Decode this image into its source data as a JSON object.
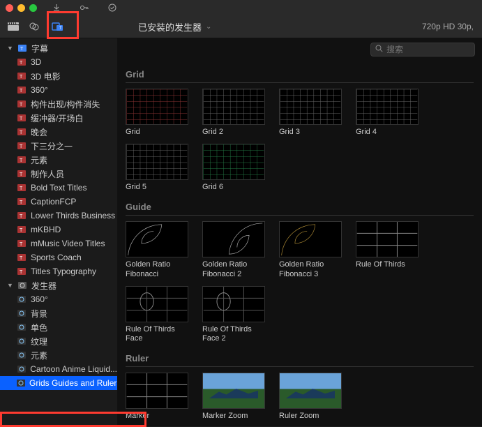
{
  "titlebar": {
    "download": "↓",
    "key": "⚿",
    "check": "✓"
  },
  "topbar": {
    "dropdown_label": "已安装的发生器",
    "format": "720p HD 30p,"
  },
  "search": {
    "placeholder": "搜索"
  },
  "sidebar": {
    "cat_titles": {
      "label": "字幕"
    },
    "cat_gen": {
      "label": "发生器"
    },
    "titles": [
      {
        "label": "3D"
      },
      {
        "label": "3D 电影"
      },
      {
        "label": "360°"
      },
      {
        "label": "构件出现/构件消失"
      },
      {
        "label": "缓冲器/开场白"
      },
      {
        "label": "晚会"
      },
      {
        "label": "下三分之一"
      },
      {
        "label": "元素"
      },
      {
        "label": "制作人员"
      },
      {
        "label": "Bold Text Titles"
      },
      {
        "label": "CaptionFCP"
      },
      {
        "label": "Lower Thirds Business"
      },
      {
        "label": "mKBHD"
      },
      {
        "label": "mMusic Video Titles"
      },
      {
        "label": "Sports Coach"
      },
      {
        "label": "Titles Typography"
      }
    ],
    "gens": [
      {
        "label": "360°"
      },
      {
        "label": "背景"
      },
      {
        "label": "单色"
      },
      {
        "label": "纹理"
      },
      {
        "label": "元素"
      },
      {
        "label": "Cartoon Anime Liquid..."
      },
      {
        "label": "Grids Guides and Rulers",
        "sel": true
      }
    ]
  },
  "sections": {
    "grid": "Grid",
    "guide": "Guide",
    "ruler": "Ruler",
    "grid_items": [
      {
        "name": "Grid"
      },
      {
        "name": "Grid 2"
      },
      {
        "name": "Grid 3"
      },
      {
        "name": "Grid 4"
      },
      {
        "name": "Grid 5"
      },
      {
        "name": "Grid 6"
      }
    ],
    "guide_items": [
      {
        "name": "Golden Ratio Fibonacci"
      },
      {
        "name": "Golden Ratio Fibonacci 2"
      },
      {
        "name": "Golden Ratio Fibonacci 3"
      },
      {
        "name": "Rule Of Thirds"
      },
      {
        "name": "Rule Of Thirds Face"
      },
      {
        "name": "Rule Of Thirds Face 2"
      }
    ],
    "ruler_items": [
      {
        "name": "Marker"
      },
      {
        "name": "Marker Zoom"
      },
      {
        "name": "Ruler Zoom"
      }
    ]
  }
}
